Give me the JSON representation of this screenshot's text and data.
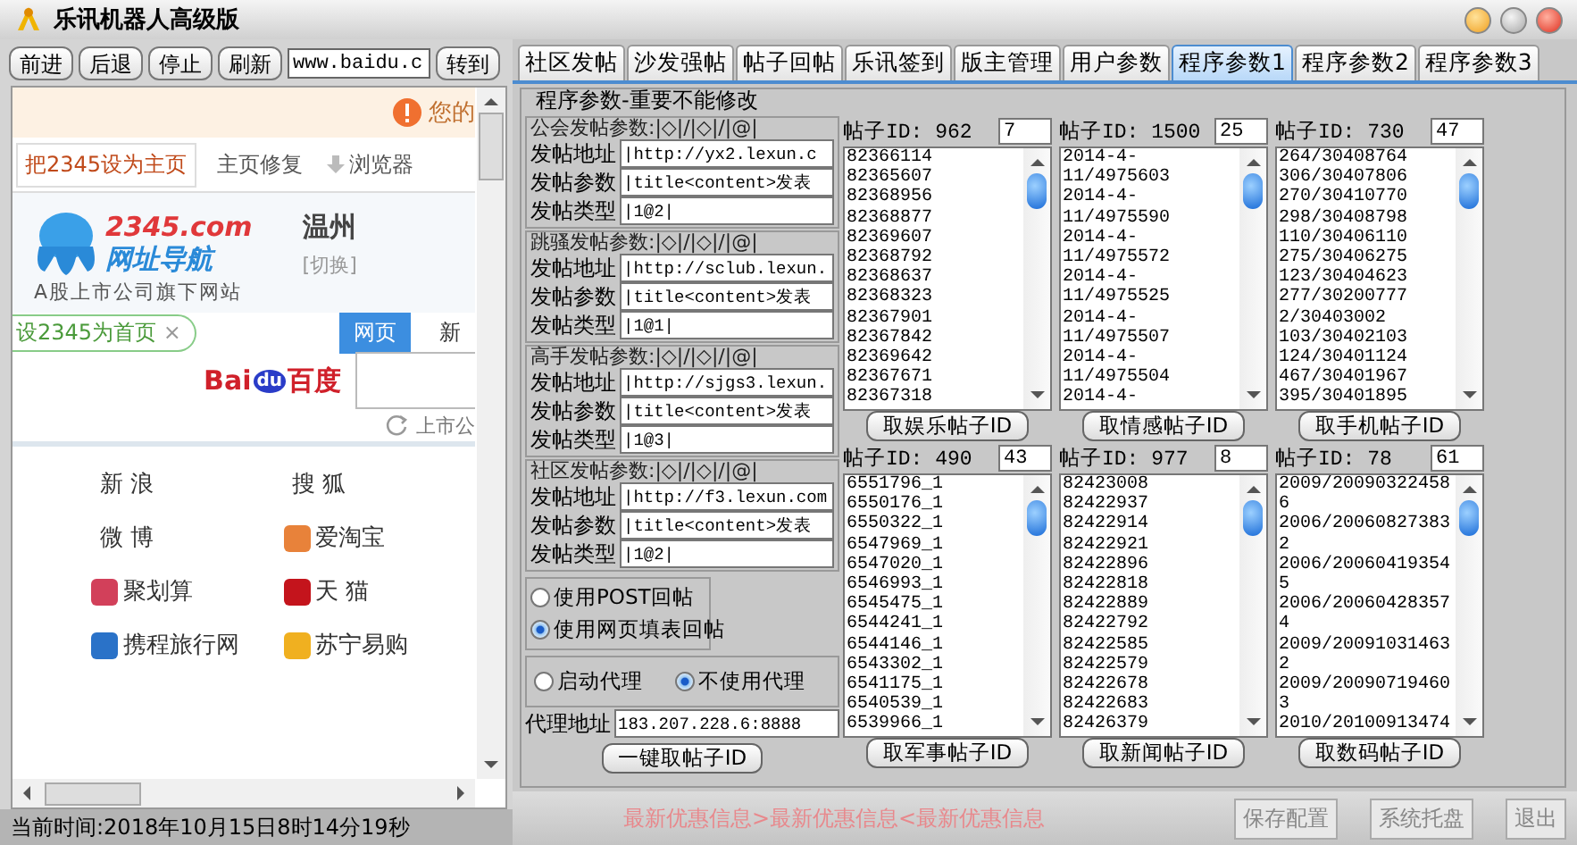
{
  "window": {
    "title": "乐讯机器人高级版"
  },
  "browser": {
    "nav_buttons": [
      "前进",
      "后退",
      "停止",
      "刷新"
    ],
    "url": "www.baidu.c",
    "go_button": "转到",
    "notice": "您的",
    "top_links": [
      {
        "label": "把2345设为主页",
        "kind": "framed"
      },
      {
        "label": "主页修复",
        "kind": "plain"
      },
      {
        "label": "浏览器",
        "kind": "download"
      }
    ],
    "logo": {
      "brand": "2345.com",
      "name": "网址导航",
      "tagline": "A股上市公司旗下网站"
    },
    "city": "温州",
    "city_switch": "[切换]",
    "set_home": "设2345为首页",
    "set_home_close": "×",
    "search_tabs": [
      {
        "label": "网页",
        "selected": true
      },
      {
        "label": "新",
        "selected": false
      }
    ],
    "baidu": {
      "left": "Bai",
      "paw": "du",
      "right": "百度"
    },
    "search_hint": "上市公",
    "sites": [
      {
        "label": "新 浪",
        "kind": "plain"
      },
      {
        "label": "搜 狐",
        "kind": "plain"
      },
      {
        "label": "微 博",
        "kind": "plain"
      },
      {
        "label": "爱淘宝",
        "kind": "icon",
        "color": "#e8823a"
      },
      {
        "label": "聚划算",
        "kind": "icon",
        "color": "#d2405a"
      },
      {
        "label": "天 猫",
        "kind": "icon",
        "color": "#c4141c"
      },
      {
        "label": "携程旅行网",
        "kind": "icon",
        "color": "#2a72c8"
      },
      {
        "label": "苏宁易购",
        "kind": "icon",
        "color": "#f0b020"
      }
    ]
  },
  "status_bar": "当前时间:2018年10月15日8时14分19秒",
  "tabs": [
    {
      "label": "社区发帖",
      "selected": false
    },
    {
      "label": "沙发强帖",
      "selected": false
    },
    {
      "label": "帖子回帖",
      "selected": false
    },
    {
      "label": "乐讯签到",
      "selected": false
    },
    {
      "label": "版主管理",
      "selected": false
    },
    {
      "label": "用户参数",
      "selected": false
    },
    {
      "label": "程序参数1",
      "selected": true
    },
    {
      "label": "程序参数2",
      "selected": false
    },
    {
      "label": "程序参数3",
      "selected": false
    }
  ],
  "panel": {
    "title": "程序参数-重要不能修改",
    "groups": [
      {
        "legend": "公会发帖参数:|◇|/|◇|/|@|",
        "rows": [
          {
            "label": "发帖地址",
            "value": "|http://yx2.lexun.c"
          },
          {
            "label": "发帖参数",
            "value": "|title<content>发表"
          },
          {
            "label": "发帖类型",
            "value": "|1@2|"
          }
        ]
      },
      {
        "legend": "跳骚发帖参数:|◇|/|◇|/|@|",
        "rows": [
          {
            "label": "发帖地址",
            "value": "|http://sclub.lexun."
          },
          {
            "label": "发帖参数",
            "value": "|title<content>发表"
          },
          {
            "label": "发帖类型",
            "value": "|1@1|"
          }
        ]
      },
      {
        "legend": "高手发帖参数:|◇|/|◇|/|@|",
        "rows": [
          {
            "label": "发帖地址",
            "value": "|http://sjgs3.lexun."
          },
          {
            "label": "发帖参数",
            "value": "|title<content>发表"
          },
          {
            "label": "发帖类型",
            "value": "|1@3|"
          }
        ]
      },
      {
        "legend": "社区发帖参数:|◇|/|◇|/|@|",
        "rows": [
          {
            "label": "发帖地址",
            "value": "|http://f3.lexun.com"
          },
          {
            "label": "发帖参数",
            "value": "|title<content>发表"
          },
          {
            "label": "发帖类型",
            "value": "|1@2|"
          }
        ]
      }
    ],
    "reply_modes": [
      {
        "label": "使用POST回帖",
        "selected": false
      },
      {
        "label": "使用网页填表回帖",
        "selected": true
      }
    ],
    "proxy_modes": [
      {
        "label": "启动代理",
        "selected": false
      },
      {
        "label": "不使用代理",
        "selected": true
      }
    ],
    "proxy_address": {
      "label": "代理地址",
      "value": "183.207.228.6:8888"
    },
    "fetch_all_button": "一键取帖子ID",
    "lists": [
      {
        "header": "帖子ID: 962",
        "count": "7",
        "button": "取娱乐帖子ID",
        "items": [
          "82366114",
          "82365607",
          "82368956",
          "82368877",
          "82369607",
          "82368792",
          "82368637",
          "82368323",
          "82367901",
          "82367842",
          "82369642",
          "82367671",
          "82367318"
        ]
      },
      {
        "header": "帖子ID: 1500",
        "count": "25",
        "button": "取情感帖子ID",
        "items": [
          "2014-4-",
          "11/4975603",
          "2014-4-",
          "11/4975590",
          "2014-4-",
          "11/4975572",
          "2014-4-",
          "11/4975525",
          "2014-4-",
          "11/4975507",
          "2014-4-",
          "11/4975504",
          "2014-4-"
        ]
      },
      {
        "header": "帖子ID: 730",
        "count": "47",
        "button": "取手机帖子ID",
        "items": [
          "264/30408764",
          "306/30407806",
          "270/30410770",
          "298/30408798",
          "110/30406110",
          "275/30406275",
          "123/30404623",
          "277/30200777",
          "2/30403002",
          "103/30402103",
          "124/30401124",
          "467/30401967",
          "395/30401895"
        ]
      },
      {
        "header": "帖子ID: 490",
        "count": "43",
        "button": "取军事帖子ID",
        "items": [
          "6551796_1",
          "6550176_1",
          "6550322_1",
          "6547969_1",
          "6547020_1",
          "6546993_1",
          "6545475_1",
          "6544241_1",
          "6544146_1",
          "6543302_1",
          "6541175_1",
          "6540539_1",
          "6539966_1"
        ]
      },
      {
        "header": "帖子ID: 977",
        "count": "8",
        "button": "取新闻帖子ID",
        "items": [
          "82423008",
          "82422937",
          "82422914",
          "82422921",
          "82422896",
          "82422818",
          "82422889",
          "82422792",
          "82422585",
          "82422579",
          "82422678",
          "82422683",
          "82426379"
        ]
      },
      {
        "header": "帖子ID: 78",
        "count": "61",
        "button": "取数码帖子ID",
        "items": [
          "2009/20090322458",
          "6",
          "2006/20060827383",
          "2",
          "2006/20060419354",
          "5",
          "2006/20060428357",
          "4",
          "2009/20091031463",
          "2",
          "2009/20090719460",
          "3",
          "2010/20100913474"
        ]
      }
    ]
  },
  "footer": {
    "marquee": "最新优惠信息>最新优惠信息<最新优惠信息",
    "buttons": [
      "保存配置",
      "系统托盘",
      "退出"
    ]
  }
}
